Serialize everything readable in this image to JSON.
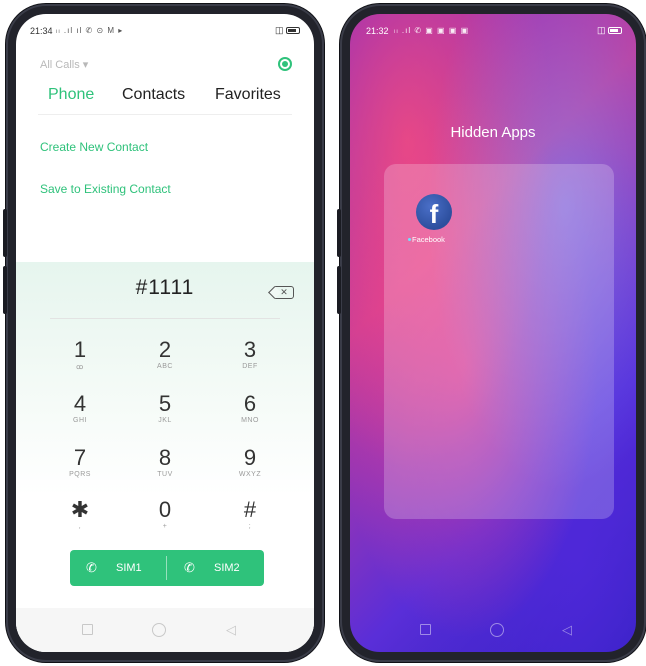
{
  "dialer": {
    "status": {
      "time": "21:34",
      "icons_text": "ₗₗ .ıl ıl ✆ ⊙ M ▸",
      "right_icons_text": "◫"
    },
    "filter_label": "All Calls ▾",
    "tabs": {
      "phone": "Phone",
      "contacts": "Contacts",
      "favorites": "Favorites"
    },
    "actions": {
      "create": "Create New Contact",
      "save": "Save to Existing Contact"
    },
    "number": "#1111",
    "backspace_glyph": "✕",
    "keys": [
      {
        "digit": "1",
        "letters": "ꝏ"
      },
      {
        "digit": "2",
        "letters": "ABC"
      },
      {
        "digit": "3",
        "letters": "DEF"
      },
      {
        "digit": "4",
        "letters": "GHI"
      },
      {
        "digit": "5",
        "letters": "JKL"
      },
      {
        "digit": "6",
        "letters": "MNO"
      },
      {
        "digit": "7",
        "letters": "PQRS"
      },
      {
        "digit": "8",
        "letters": "TUV"
      },
      {
        "digit": "9",
        "letters": "WXYZ"
      },
      {
        "digit": "✱",
        "letters": ","
      },
      {
        "digit": "0",
        "letters": "+"
      },
      {
        "digit": "#",
        "letters": ";"
      }
    ],
    "sim1": "SIM1",
    "sim2": "SIM2",
    "phone_glyph": "✆"
  },
  "hidden_apps": {
    "status": {
      "time": "21:32",
      "icons_text": "ₗₗ .ıl ✆ ▣ ▣ ▣ ▣",
      "right_icons_text": "◫"
    },
    "title": "Hidden Apps",
    "apps": [
      {
        "name": "Facebook",
        "glyph": "f"
      }
    ]
  },
  "nav": {
    "back_glyph": "◁"
  },
  "colors": {
    "accent": "#2fc27b",
    "frame": "#22232b"
  }
}
